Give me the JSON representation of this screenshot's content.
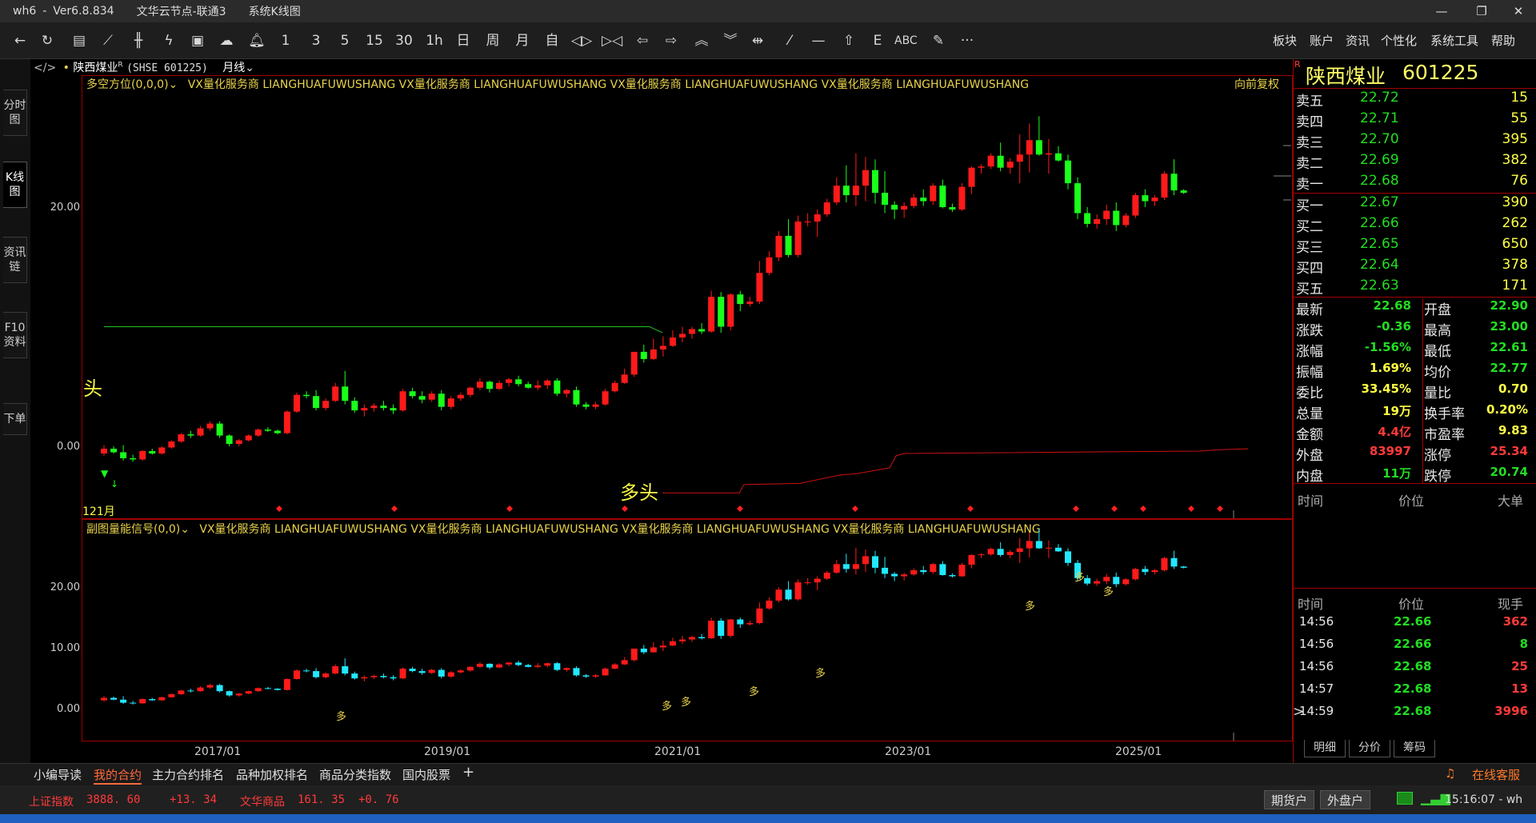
{
  "window": {
    "app": "wh6",
    "version": "Ver6.8.834",
    "node": "文华云节点-联通3",
    "mode": "系统K线图"
  },
  "toolbar": {
    "periods": [
      "1",
      "3",
      "5",
      "15",
      "30",
      "1h",
      "日",
      "周",
      "月",
      "自"
    ],
    "text_tool": "ABC",
    "more": "···",
    "menus": [
      "板块",
      "账户",
      "资讯",
      "个性化",
      "系统工具",
      "帮助"
    ]
  },
  "left_tabs": [
    "分时图",
    "K线图",
    "资讯链",
    "F10资料",
    "下单"
  ],
  "chart_header": {
    "stock": "陕西煤业",
    "superscript": "R",
    "code": "(SHSE 601225)",
    "period": "月线"
  },
  "main_indicator": {
    "name": "多空方位(0,0,0)",
    "watermark": "VX量化服务商  LIANGHUAFUWUSHANG  VX量化服务商  LIANGHUAFUWUSHANG  VX量化服务商  LIANGHUAFUWUSHANG  VX量化服务商  LIANGHUAFUWUSHANG",
    "adjust": "向前复权",
    "label_left": "头",
    "label_duotou": "多头",
    "first_month": "121月"
  },
  "sub_indicator": {
    "name": "副图量能信号(0,0)",
    "watermark": "VX量化服务商  LIANGHUAFUWUSHANG  VX量化服务商  LIANGHUAFUWUSHANG  VX量化服务商  LIANGHUAFUWUSHANG  VX量化服务商  LIANGHUAFUWUSHANG",
    "signal": "多"
  },
  "chart_data": [
    {
      "type": "candlestick",
      "panel": "main",
      "ytick_labels": [
        "20.00",
        "0.00"
      ],
      "xtick_labels": [
        "2017/01",
        "2019/01",
        "2021/01",
        "2023/01",
        "2025/01"
      ],
      "annotations": [
        "头",
        "多头",
        "121月"
      ],
      "colors": {
        "up": "#ff1a1a",
        "down": "#1aff1a",
        "line_green": "#1fbf1f",
        "line_red": "#cc1111"
      },
      "note_values": "Monthly bars (approximate, estimated from pixel positions)",
      "candles": [
        [
          0.9,
          1.6,
          0.7,
          1.3
        ],
        [
          1.3,
          1.5,
          0.9,
          1.0
        ],
        [
          1.0,
          1.6,
          0.3,
          0.5
        ],
        [
          0.5,
          0.8,
          0.2,
          0.4
        ],
        [
          0.4,
          1.2,
          0.3,
          1.1
        ],
        [
          1.1,
          1.3,
          0.8,
          0.9
        ],
        [
          0.9,
          1.5,
          0.8,
          1.4
        ],
        [
          1.4,
          2.0,
          1.3,
          1.9
        ],
        [
          1.9,
          2.6,
          1.8,
          2.5
        ],
        [
          2.5,
          2.8,
          2.2,
          2.4
        ],
        [
          2.4,
          3.2,
          2.3,
          3.0
        ],
        [
          3.0,
          3.6,
          2.8,
          3.4
        ],
        [
          3.4,
          3.6,
          2.2,
          2.4
        ],
        [
          2.4,
          2.5,
          1.5,
          1.7
        ],
        [
          1.7,
          2.1,
          1.5,
          2.0
        ],
        [
          2.0,
          2.5,
          1.9,
          2.4
        ],
        [
          2.4,
          3.0,
          2.3,
          2.9
        ],
        [
          2.9,
          3.1,
          2.7,
          2.8
        ],
        [
          2.8,
          2.9,
          2.5,
          2.6
        ],
        [
          2.6,
          4.5,
          2.5,
          4.4
        ],
        [
          4.4,
          6.0,
          4.3,
          5.8
        ],
        [
          5.8,
          6.1,
          5.5,
          5.7
        ],
        [
          5.7,
          6.2,
          4.5,
          4.7
        ],
        [
          4.7,
          5.5,
          4.5,
          5.3
        ],
        [
          5.3,
          6.8,
          5.2,
          6.5
        ],
        [
          6.5,
          7.8,
          5.0,
          5.3
        ],
        [
          5.3,
          5.6,
          4.3,
          4.5
        ],
        [
          4.5,
          5.0,
          4.0,
          4.7
        ],
        [
          4.7,
          5.1,
          4.4,
          4.9
        ],
        [
          4.9,
          5.3,
          4.5,
          4.7
        ],
        [
          4.7,
          5.0,
          4.2,
          4.5
        ],
        [
          4.5,
          6.3,
          4.4,
          6.1
        ],
        [
          6.1,
          6.4,
          5.5,
          5.7
        ],
        [
          5.7,
          6.1,
          5.1,
          5.4
        ],
        [
          5.4,
          6.1,
          5.2,
          5.9
        ],
        [
          5.9,
          6.2,
          4.5,
          4.8
        ],
        [
          4.8,
          5.7,
          4.6,
          5.5
        ],
        [
          5.5,
          6.0,
          5.3,
          5.8
        ],
        [
          5.8,
          6.5,
          5.6,
          6.4
        ],
        [
          6.4,
          7.2,
          6.2,
          6.9
        ],
        [
          6.9,
          7.0,
          6.0,
          6.3
        ],
        [
          6.3,
          7.0,
          6.2,
          6.8
        ],
        [
          6.8,
          7.2,
          6.5,
          7.1
        ],
        [
          7.1,
          7.4,
          6.5,
          6.7
        ],
        [
          6.7,
          6.9,
          6.3,
          6.4
        ],
        [
          6.4,
          7.0,
          6.2,
          6.6
        ],
        [
          6.6,
          7.1,
          6.3,
          7.0
        ],
        [
          7.0,
          7.2,
          5.7,
          5.9
        ],
        [
          5.9,
          6.3,
          5.6,
          6.2
        ],
        [
          6.2,
          6.5,
          4.8,
          5.0
        ],
        [
          5.0,
          5.2,
          4.6,
          4.8
        ],
        [
          4.8,
          5.2,
          4.6,
          5.0
        ],
        [
          5.0,
          6.3,
          4.9,
          6.1
        ],
        [
          6.1,
          7.0,
          6.0,
          6.8
        ],
        [
          6.8,
          8.0,
          6.7,
          7.5
        ],
        [
          7.5,
          9.0,
          7.3,
          9.4
        ],
        [
          9.4,
          10.0,
          8.5,
          8.8
        ],
        [
          8.8,
          10.5,
          8.7,
          9.6
        ],
        [
          9.6,
          10.7,
          9.0,
          9.9
        ],
        [
          9.9,
          11.2,
          9.8,
          10.6
        ],
        [
          10.6,
          11.5,
          10.2,
          10.9
        ],
        [
          10.9,
          11.5,
          10.5,
          11.3
        ],
        [
          11.3,
          11.8,
          10.9,
          11.1
        ],
        [
          11.1,
          14.5,
          11.0,
          14.0
        ],
        [
          14.0,
          14.4,
          11.0,
          11.5
        ],
        [
          11.5,
          14.3,
          11.2,
          14.2
        ],
        [
          14.2,
          14.5,
          12.8,
          13.4
        ],
        [
          13.4,
          14.0,
          13.2,
          13.6
        ],
        [
          13.6,
          17.0,
          13.4,
          16.0
        ],
        [
          16.0,
          17.8,
          15.8,
          17.3
        ],
        [
          17.3,
          19.5,
          17.0,
          19.1
        ],
        [
          19.1,
          20.5,
          17.3,
          17.5
        ],
        [
          17.5,
          20.8,
          17.3,
          20.3
        ],
        [
          20.3,
          21.0,
          19.9,
          20.3
        ],
        [
          20.3,
          21.3,
          19.0,
          20.9
        ],
        [
          20.9,
          22.2,
          20.7,
          21.9
        ],
        [
          21.9,
          24.0,
          21.7,
          23.3
        ],
        [
          23.3,
          25.0,
          21.9,
          22.5
        ],
        [
          22.5,
          26.0,
          21.6,
          23.3
        ],
        [
          23.3,
          25.7,
          22.0,
          24.6
        ],
        [
          24.6,
          25.5,
          21.8,
          22.7
        ],
        [
          22.7,
          24.5,
          21.0,
          21.7
        ],
        [
          21.7,
          22.0,
          20.5,
          21.3
        ],
        [
          21.3,
          21.9,
          20.6,
          21.6
        ],
        [
          21.6,
          22.6,
          21.4,
          22.3
        ],
        [
          22.3,
          23.0,
          21.6,
          22.0
        ],
        [
          22.0,
          23.5,
          21.7,
          23.3
        ],
        [
          23.3,
          23.8,
          21.4,
          21.5
        ],
        [
          21.5,
          21.8,
          21.1,
          21.3
        ],
        [
          21.3,
          23.5,
          21.2,
          23.2
        ],
        [
          23.2,
          24.9,
          22.6,
          24.8
        ],
        [
          24.8,
          25.1,
          24.3,
          24.9
        ],
        [
          24.9,
          26.0,
          24.7,
          25.8
        ],
        [
          25.8,
          26.9,
          24.5,
          24.8
        ],
        [
          24.8,
          25.6,
          24.3,
          25.3
        ],
        [
          25.3,
          27.6,
          23.5,
          25.9
        ],
        [
          25.9,
          28.5,
          24.4,
          27.1
        ],
        [
          27.1,
          29.1,
          25.8,
          25.9
        ],
        [
          25.9,
          27.2,
          24.3,
          26.0
        ],
        [
          26.0,
          26.6,
          25.3,
          25.4
        ],
        [
          25.4,
          25.9,
          23.0,
          23.5
        ],
        [
          23.5,
          24.0,
          20.5,
          21.0
        ],
        [
          21.0,
          21.5,
          19.8,
          20.1
        ],
        [
          20.1,
          20.9,
          19.7,
          20.5
        ],
        [
          20.5,
          21.7,
          20.0,
          21.2
        ],
        [
          21.2,
          21.9,
          19.5,
          20.0
        ],
        [
          20.0,
          21.0,
          19.8,
          20.8
        ],
        [
          20.8,
          22.7,
          20.6,
          22.5
        ],
        [
          22.5,
          23.0,
          21.5,
          22.0
        ],
        [
          22.0,
          22.5,
          21.6,
          22.3
        ],
        [
          22.3,
          24.5,
          22.1,
          24.3
        ],
        [
          24.3,
          25.5,
          22.5,
          22.9
        ],
        [
          22.9,
          23.0,
          22.6,
          22.7
        ]
      ]
    },
    {
      "type": "candlestick",
      "panel": "sub",
      "ytick_labels": [
        "20.00",
        "10.00",
        "0.00"
      ],
      "colors": {
        "up": "#ff1a1a",
        "down": "#22e8ff",
        "signal": "#e8d24a"
      }
    }
  ],
  "quote": {
    "name": "陕西煤业",
    "code": "601225",
    "asks": [
      {
        "label": "卖五",
        "price": "22.72",
        "vol": "15"
      },
      {
        "label": "卖四",
        "price": "22.71",
        "vol": "55"
      },
      {
        "label": "卖三",
        "price": "22.70",
        "vol": "395"
      },
      {
        "label": "卖二",
        "price": "22.69",
        "vol": "382"
      },
      {
        "label": "卖一",
        "price": "22.68",
        "vol": "76"
      }
    ],
    "bids": [
      {
        "label": "买一",
        "price": "22.67",
        "vol": "390"
      },
      {
        "label": "买二",
        "price": "22.66",
        "vol": "262"
      },
      {
        "label": "买三",
        "price": "22.65",
        "vol": "650"
      },
      {
        "label": "买四",
        "price": "22.64",
        "vol": "378"
      },
      {
        "label": "买五",
        "price": "22.63",
        "vol": "171"
      }
    ],
    "stats": [
      {
        "l1": "最新",
        "v1": "22.68",
        "c1": "green",
        "l2": "开盘",
        "v2": "22.90",
        "c2": "green"
      },
      {
        "l1": "涨跌",
        "v1": "-0.36",
        "c1": "green",
        "l2": "最高",
        "v2": "23.00",
        "c2": "green"
      },
      {
        "l1": "涨幅",
        "v1": "-1.56%",
        "c1": "green",
        "l2": "最低",
        "v2": "22.61",
        "c2": "green"
      },
      {
        "l1": "振幅",
        "v1": "1.69%",
        "c1": "yellow",
        "l2": "均价",
        "v2": "22.77",
        "c2": "green"
      },
      {
        "l1": "委比",
        "v1": "33.45%",
        "c1": "yellow",
        "l2": "量比",
        "v2": "0.70",
        "c2": "yellow"
      },
      {
        "l1": "总量",
        "v1": "19万",
        "c1": "yellow",
        "l2": "换手率",
        "v2": "0.20%",
        "c2": "yellow"
      },
      {
        "l1": "金额",
        "v1": "4.4亿",
        "c1": "red",
        "l2": "市盈率",
        "v2": "9.83",
        "c2": "yellow"
      },
      {
        "l1": "外盘",
        "v1": "83997",
        "c1": "red",
        "l2": "涨停",
        "v2": "25.34",
        "c2": "red"
      },
      {
        "l1": "内盘",
        "v1": "11万",
        "c1": "green",
        "l2": "跌停",
        "v2": "20.74",
        "c2": "green"
      }
    ],
    "block_header": [
      "时间",
      "价位",
      "大单"
    ],
    "tick_header": [
      "时间",
      "价位",
      "现手"
    ],
    "ticks": [
      {
        "time": "14:56",
        "price": "22.66",
        "vol": "362",
        "vc": "red"
      },
      {
        "time": "14:56",
        "price": "22.66",
        "vol": "8",
        "vc": "green"
      },
      {
        "time": "14:56",
        "price": "22.68",
        "vol": "25",
        "vc": "red"
      },
      {
        "time": "14:57",
        "price": "22.68",
        "vol": "13",
        "vc": "red"
      },
      {
        "time": "14:59",
        "price": "22.68",
        "vol": "3996",
        "vc": "red",
        "marker": ">"
      }
    ],
    "tabs": [
      "明细",
      "分价",
      "筹码"
    ]
  },
  "bottom_tabs": [
    "小编导读",
    "我的合约",
    "主力合约排名",
    "品种加权排名",
    "商品分类指数",
    "国内股票"
  ],
  "bottom_add": "+",
  "service": "在线客服",
  "status": {
    "index1_name": "上证指数",
    "index1_value": "3888. 60",
    "index1_change": "+13. 34",
    "index2_name": "文华商品",
    "index2_value": "161. 35",
    "index2_change": "+0. 76",
    "btn_futures": "期货户",
    "btn_external": "外盘户",
    "clock": "15:16:07 - wh"
  }
}
